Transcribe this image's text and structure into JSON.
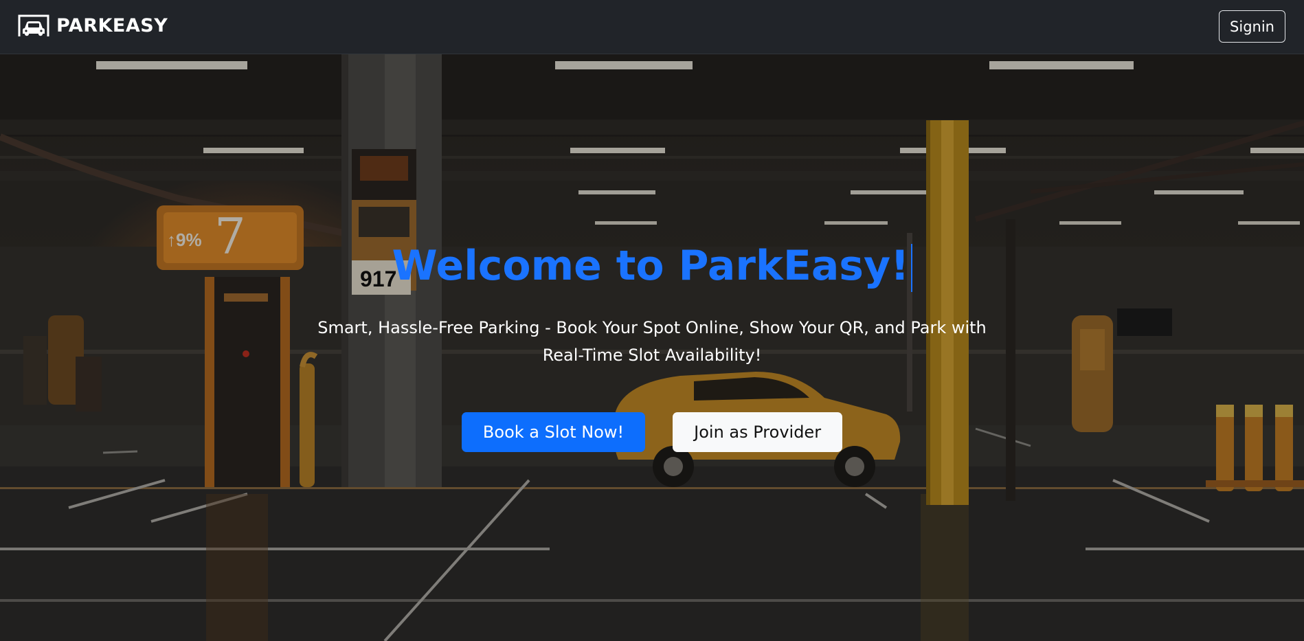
{
  "navbar": {
    "brand_name": "PARKEASY",
    "brand_icon": "car-logo-icon",
    "signin_label": "Signin"
  },
  "hero": {
    "title": "Welcome to ParkEasy!",
    "subtitle": "Smart, Hassle-Free Parking - Book Your Spot Online, Show Your QR, and Park with Real-Time Slot Availability!",
    "primary_button": "Book a Slot Now!",
    "secondary_button": "Join as Provider",
    "sign_text": "↑9%",
    "sign_number": "7",
    "pillar_sign": "917"
  },
  "colors": {
    "navbar_bg": "#212429",
    "accent_blue": "#1a73ff",
    "primary_button": "#0d6efd",
    "light_button": "#f8f9fa"
  }
}
